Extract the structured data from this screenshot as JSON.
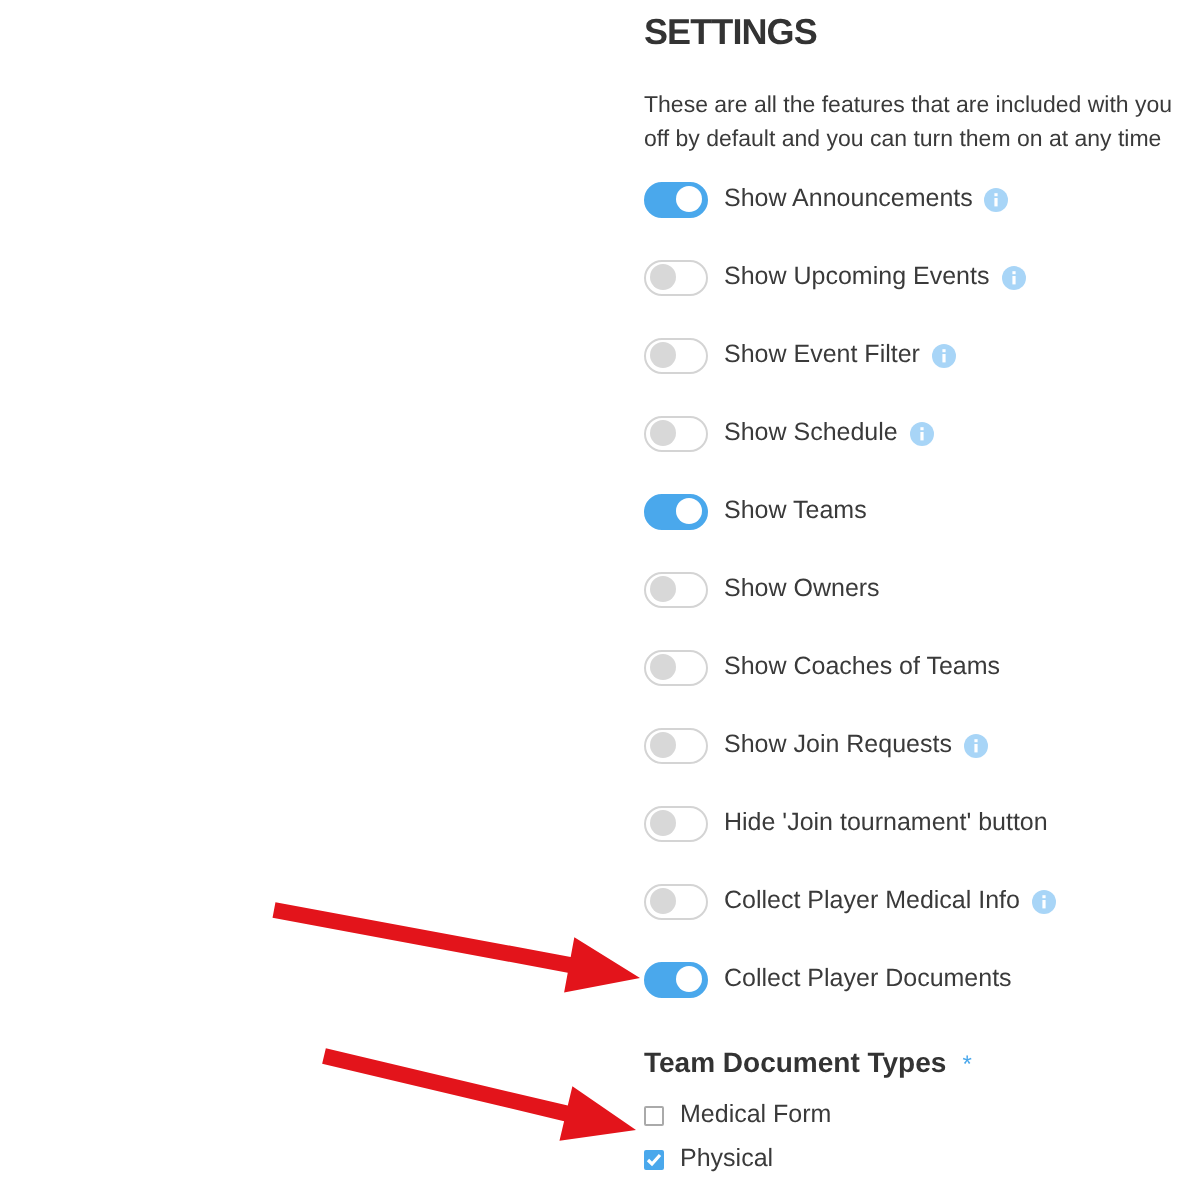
{
  "title": "SETTINGS",
  "description": [
    "These are all the features that are included with you",
    "off by default and you can turn them on at any time"
  ],
  "settings": [
    {
      "label": "Show Announcements",
      "on": true,
      "info": true
    },
    {
      "label": "Show Upcoming Events",
      "on": false,
      "info": true
    },
    {
      "label": "Show Event Filter",
      "on": false,
      "info": true
    },
    {
      "label": "Show Schedule",
      "on": false,
      "info": true
    },
    {
      "label": "Show Teams",
      "on": true,
      "info": false
    },
    {
      "label": "Show Owners",
      "on": false,
      "info": false
    },
    {
      "label": "Show Coaches of Teams",
      "on": false,
      "info": false
    },
    {
      "label": "Show Join Requests",
      "on": false,
      "info": true
    },
    {
      "label": "Hide 'Join tournament' button",
      "on": false,
      "info": false
    },
    {
      "label": "Collect Player Medical Info",
      "on": false,
      "info": true
    },
    {
      "label": "Collect Player Documents",
      "on": true,
      "info": false
    }
  ],
  "document_types": {
    "title": "Team Document Types",
    "required_mark": "*",
    "options": [
      {
        "label": "Medical Form",
        "checked": false
      },
      {
        "label": "Physical",
        "checked": true
      }
    ]
  }
}
